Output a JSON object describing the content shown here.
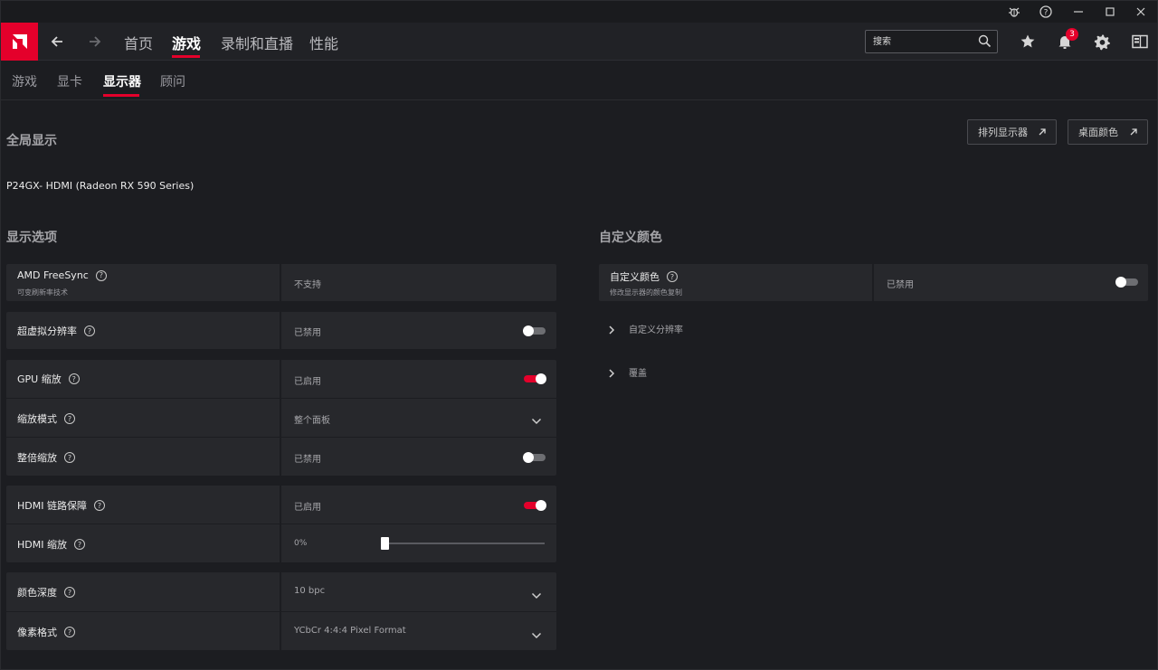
{
  "colors": {
    "accent": "#e4002b",
    "background": "#1c1d21",
    "card": "#27282c"
  },
  "header": {
    "nav": [
      {
        "label": "首页"
      },
      {
        "label": "游戏"
      },
      {
        "label": "录制和直播"
      },
      {
        "label": "性能"
      }
    ],
    "active_nav": "游戏",
    "search_placeholder": "搜索",
    "notification_count": "3"
  },
  "subtabs": [
    {
      "label": "游戏"
    },
    {
      "label": "显卡"
    },
    {
      "label": "显示器"
    },
    {
      "label": "顾问"
    }
  ],
  "active_subtab": "显示器",
  "page": {
    "global_display_title": "全局显示",
    "arrange_displays_label": "排列显示器",
    "desktop_color_label": "桌面颜色",
    "monitor_name": "P24GX- HDMI (Radeon RX 590 Series)",
    "display_options_title": "显示选项",
    "custom_color_title": "自定义颜色"
  },
  "display_options": {
    "freesync": {
      "label": "AMD FreeSync",
      "sublabel": "可变刷新率技术",
      "value": "不支持"
    },
    "vsr": {
      "label": "超虚拟分辨率",
      "value": "已禁用",
      "enabled": false
    },
    "gpu_scaling": {
      "label": "GPU 缩放",
      "value": "已启用",
      "enabled": true
    },
    "scaling_mode": {
      "label": "缩放模式",
      "value": "整个面板"
    },
    "integer_scaling": {
      "label": "整倍缩放",
      "value": "已禁用",
      "enabled": false
    },
    "hdmi_link": {
      "label": "HDMI 链路保障",
      "value": "已启用",
      "enabled": true
    },
    "hdmi_scaling": {
      "label": "HDMI 缩放",
      "value": "0%",
      "level": 0
    },
    "color_depth": {
      "label": "颜色深度",
      "value": "10 bpc"
    },
    "pixel_format": {
      "label": "像素格式",
      "value": "YCbCr 4:4:4 Pixel Format"
    }
  },
  "custom_color": {
    "label": "自定义颜色",
    "sublabel": "修改显示器的颜色复制",
    "value": "已禁用",
    "enabled": false,
    "expanders": [
      {
        "label": "自定义分辨率"
      },
      {
        "label": "覆盖"
      }
    ]
  }
}
